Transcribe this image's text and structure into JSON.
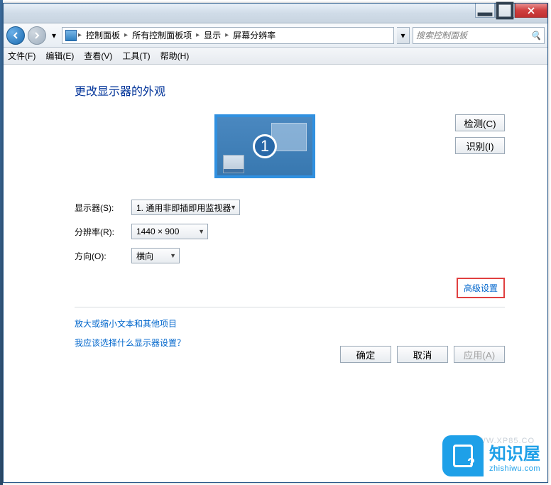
{
  "breadcrumb": {
    "items": [
      "控制面板",
      "所有控制面板项",
      "显示",
      "屏幕分辨率"
    ]
  },
  "search": {
    "placeholder": "搜索控制面板"
  },
  "menubar": {
    "file": "文件(F)",
    "edit": "编辑(E)",
    "view": "查看(V)",
    "tools": "工具(T)",
    "help": "帮助(H)"
  },
  "page": {
    "title": "更改显示器的外观",
    "monitor_number": "1",
    "detect": "检测(C)",
    "identify": "识别(I)"
  },
  "form": {
    "display_label": "显示器(S):",
    "display_value": "1. 通用非即插即用监视器",
    "resolution_label": "分辨率(R):",
    "resolution_value": "1440 × 900",
    "orientation_label": "方向(O):",
    "orientation_value": "横向"
  },
  "links": {
    "advanced": "高级设置",
    "text_size": "放大或缩小文本和其他项目",
    "which_display": "我应该选择什么显示器设置？"
  },
  "buttons": {
    "ok": "确定",
    "cancel": "取消",
    "apply": "应用(A)"
  },
  "watermark": {
    "title": "知识屋",
    "url": "zhishiwu.com",
    "faint": "WWW.XP85.CO"
  }
}
